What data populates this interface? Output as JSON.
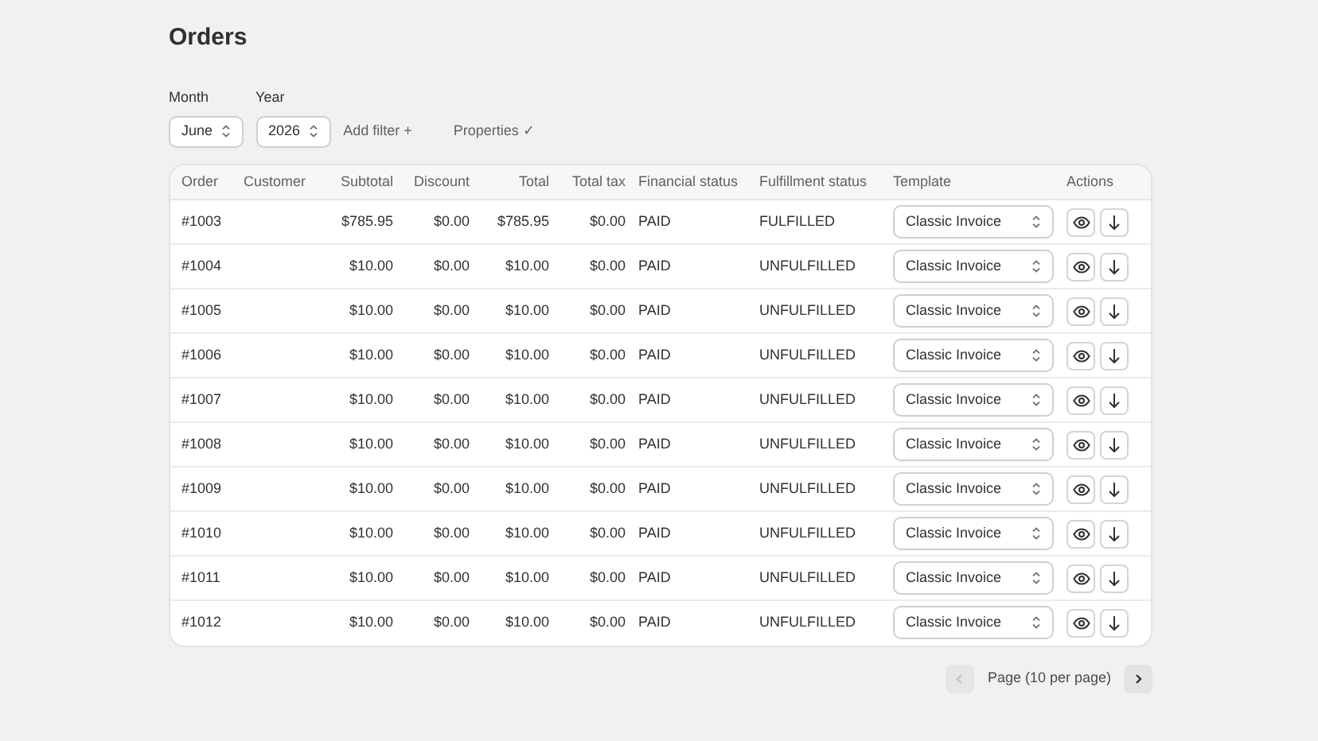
{
  "title": "Orders",
  "filters": [
    {
      "label": "Month",
      "value": "June"
    },
    {
      "label": "Year",
      "value": "2026"
    }
  ],
  "links": [
    "Add filter +",
    "Properties ✓"
  ],
  "table": {
    "columns": [
      "Order",
      "Customer",
      "Subtotal",
      "Discount",
      "Total",
      "Total tax",
      "Financial status",
      "Fulfillment status",
      "Template",
      "Actions"
    ],
    "rows": [
      {
        "order": "#1003",
        "subtotal": "$785.95",
        "discount": "$0.00",
        "total": "$785.95",
        "tax": "$0.00",
        "financial": "PAID",
        "fulfillment": "FULFILLED",
        "template": "Classic Invoice"
      },
      {
        "order": "#1004",
        "subtotal": "$10.00",
        "discount": "$0.00",
        "total": "$10.00",
        "tax": "$0.00",
        "financial": "PAID",
        "fulfillment": "UNFULFILLED",
        "template": "Classic Invoice"
      },
      {
        "order": "#1005",
        "subtotal": "$10.00",
        "discount": "$0.00",
        "total": "$10.00",
        "tax": "$0.00",
        "financial": "PAID",
        "fulfillment": "UNFULFILLED",
        "template": "Classic Invoice"
      },
      {
        "order": "#1006",
        "subtotal": "$10.00",
        "discount": "$0.00",
        "total": "$10.00",
        "tax": "$0.00",
        "financial": "PAID",
        "fulfillment": "UNFULFILLED",
        "template": "Classic Invoice"
      },
      {
        "order": "#1007",
        "subtotal": "$10.00",
        "discount": "$0.00",
        "total": "$10.00",
        "tax": "$0.00",
        "financial": "PAID",
        "fulfillment": "UNFULFILLED",
        "template": "Classic Invoice"
      },
      {
        "order": "#1008",
        "subtotal": "$10.00",
        "discount": "$0.00",
        "total": "$10.00",
        "tax": "$0.00",
        "financial": "PAID",
        "fulfillment": "UNFULFILLED",
        "template": "Classic Invoice"
      },
      {
        "order": "#1009",
        "subtotal": "$10.00",
        "discount": "$0.00",
        "total": "$10.00",
        "tax": "$0.00",
        "financial": "PAID",
        "fulfillment": "UNFULFILLED",
        "template": "Classic Invoice"
      },
      {
        "order": "#1010",
        "subtotal": "$10.00",
        "discount": "$0.00",
        "total": "$10.00",
        "tax": "$0.00",
        "financial": "PAID",
        "fulfillment": "UNFULFILLED",
        "template": "Classic Invoice"
      },
      {
        "order": "#1011",
        "subtotal": "$10.00",
        "discount": "$0.00",
        "total": "$10.00",
        "tax": "$0.00",
        "financial": "PAID",
        "fulfillment": "UNFULFILLED",
        "template": "Classic Invoice"
      },
      {
        "order": "#1012",
        "subtotal": "$10.00",
        "discount": "$0.00",
        "total": "$10.00",
        "tax": "$0.00",
        "financial": "PAID",
        "fulfillment": "UNFULFILLED",
        "template": "Classic Invoice"
      }
    ]
  },
  "pagination": {
    "label": "Page (10 per page)",
    "previous_disabled": true,
    "next_disabled": false
  }
}
